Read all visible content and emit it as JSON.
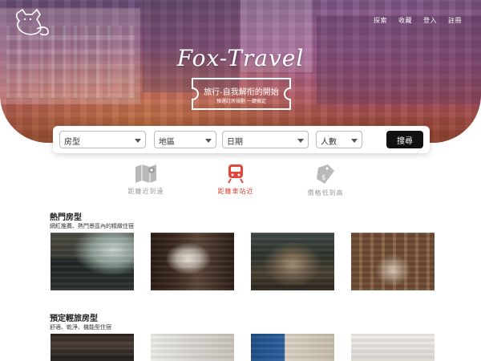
{
  "header": {
    "logo_icon": "fox-icon",
    "nav": [
      {
        "label": "探索"
      },
      {
        "label": "收藏"
      },
      {
        "label": "登入"
      },
      {
        "label": "註冊"
      }
    ]
  },
  "hero": {
    "title": "Fox-Travel",
    "ticket_title": "旅行-自我解衔的開始",
    "ticket_sub": "預選訂房規劃 一鍵搞定"
  },
  "search": {
    "room_type": "房型",
    "region": "地區",
    "date": "日期",
    "people": "人數",
    "button": "搜尋"
  },
  "sort_tabs": [
    {
      "label": "距離近到遠",
      "icon": "map-icon",
      "active": false
    },
    {
      "label": "距離車站近",
      "icon": "train-icon",
      "active": true
    },
    {
      "label": "價格低到高",
      "icon": "price-tag-icon",
      "active": false
    }
  ],
  "sections": {
    "hot": {
      "title": "熱門房型",
      "subtitle": "網紅推薦、熱門景區內的精緻住宿"
    },
    "budget": {
      "title": "預定輕旅房型",
      "subtitle": "舒適、乾淨、機能型住宿"
    }
  },
  "colors": {
    "accent": "#e0473a",
    "search_button": "#111111",
    "inactive_icon": "#b0b0b0"
  }
}
